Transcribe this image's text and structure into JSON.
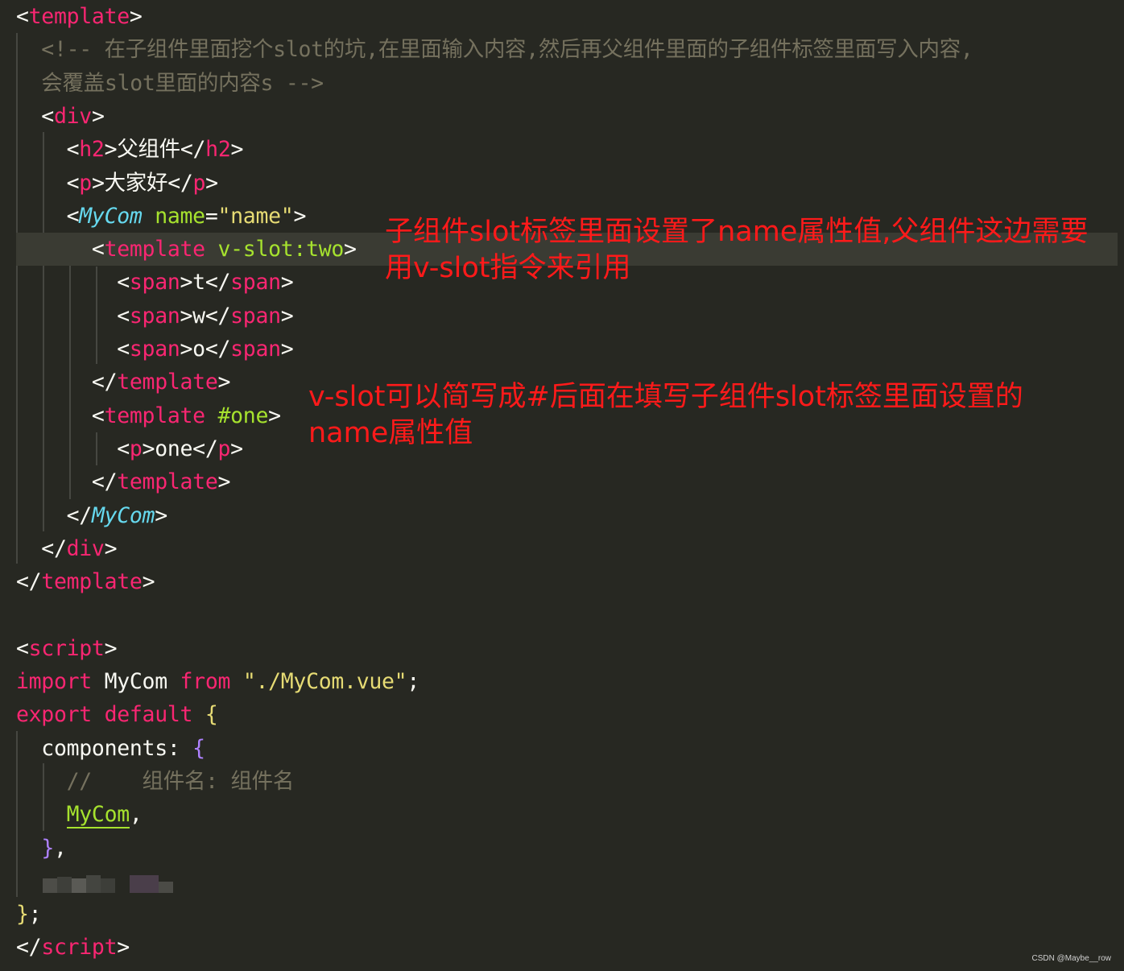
{
  "code_lines": [
    {
      "tokens": [
        {
          "t": "<",
          "c": "p"
        },
        {
          "t": "template",
          "c": "tag"
        },
        {
          "t": ">",
          "c": "p"
        }
      ]
    },
    {
      "tokens": [
        {
          "t": "  <!-- 在子组件里面挖个slot的坑,在里面输入内容,然后再父组件里面的子组件标签里面写入内容,",
          "c": "cmt"
        }
      ]
    },
    {
      "tokens": [
        {
          "t": "  会覆盖slot里面的内容s -->",
          "c": "cmt"
        }
      ]
    },
    {
      "tokens": [
        {
          "t": "  <",
          "c": "p"
        },
        {
          "t": "div",
          "c": "tag"
        },
        {
          "t": ">",
          "c": "p"
        }
      ]
    },
    {
      "tokens": [
        {
          "t": "    <",
          "c": "p"
        },
        {
          "t": "h2",
          "c": "tag"
        },
        {
          "t": ">父组件</",
          "c": "p"
        },
        {
          "t": "h2",
          "c": "tag"
        },
        {
          "t": ">",
          "c": "p"
        }
      ]
    },
    {
      "tokens": [
        {
          "t": "    <",
          "c": "p"
        },
        {
          "t": "p",
          "c": "tag"
        },
        {
          "t": ">大家好</",
          "c": "p"
        },
        {
          "t": "p",
          "c": "tag"
        },
        {
          "t": ">",
          "c": "p"
        }
      ]
    },
    {
      "tokens": [
        {
          "t": "    <",
          "c": "p"
        },
        {
          "t": "MyCom",
          "c": "cmp"
        },
        {
          "t": " ",
          "c": "p"
        },
        {
          "t": "name",
          "c": "attr"
        },
        {
          "t": "=",
          "c": "p"
        },
        {
          "t": "\"name\"",
          "c": "str"
        },
        {
          "t": ">",
          "c": "p"
        }
      ]
    },
    {
      "tokens": [
        {
          "t": "      <",
          "c": "p"
        },
        {
          "t": "template",
          "c": "tag"
        },
        {
          "t": " ",
          "c": "p"
        },
        {
          "t": "v-slot:two",
          "c": "attr"
        },
        {
          "t": ">",
          "c": "p"
        }
      ],
      "highlight": true
    },
    {
      "tokens": [
        {
          "t": "        <",
          "c": "p"
        },
        {
          "t": "span",
          "c": "tag"
        },
        {
          "t": ">t</",
          "c": "p"
        },
        {
          "t": "span",
          "c": "tag"
        },
        {
          "t": ">",
          "c": "p"
        }
      ]
    },
    {
      "tokens": [
        {
          "t": "        <",
          "c": "p"
        },
        {
          "t": "span",
          "c": "tag"
        },
        {
          "t": ">w</",
          "c": "p"
        },
        {
          "t": "span",
          "c": "tag"
        },
        {
          "t": ">",
          "c": "p"
        }
      ]
    },
    {
      "tokens": [
        {
          "t": "        <",
          "c": "p"
        },
        {
          "t": "span",
          "c": "tag"
        },
        {
          "t": ">o</",
          "c": "p"
        },
        {
          "t": "span",
          "c": "tag"
        },
        {
          "t": ">",
          "c": "p"
        }
      ]
    },
    {
      "tokens": [
        {
          "t": "      </",
          "c": "p"
        },
        {
          "t": "template",
          "c": "tag"
        },
        {
          "t": ">",
          "c": "p"
        }
      ]
    },
    {
      "tokens": [
        {
          "t": "      <",
          "c": "p"
        },
        {
          "t": "template",
          "c": "tag"
        },
        {
          "t": " ",
          "c": "p"
        },
        {
          "t": "#one",
          "c": "attr"
        },
        {
          "t": ">",
          "c": "p"
        }
      ]
    },
    {
      "tokens": [
        {
          "t": "        <",
          "c": "p"
        },
        {
          "t": "p",
          "c": "tag"
        },
        {
          "t": ">one</",
          "c": "p"
        },
        {
          "t": "p",
          "c": "tag"
        },
        {
          "t": ">",
          "c": "p"
        }
      ]
    },
    {
      "tokens": [
        {
          "t": "      </",
          "c": "p"
        },
        {
          "t": "template",
          "c": "tag"
        },
        {
          "t": ">",
          "c": "p"
        }
      ]
    },
    {
      "tokens": [
        {
          "t": "    </",
          "c": "p"
        },
        {
          "t": "MyCom",
          "c": "cmp"
        },
        {
          "t": ">",
          "c": "p"
        }
      ]
    },
    {
      "tokens": [
        {
          "t": "  </",
          "c": "p"
        },
        {
          "t": "div",
          "c": "tag"
        },
        {
          "t": ">",
          "c": "p"
        }
      ]
    },
    {
      "tokens": [
        {
          "t": "</",
          "c": "p"
        },
        {
          "t": "template",
          "c": "tag"
        },
        {
          "t": ">",
          "c": "p"
        }
      ]
    },
    {
      "tokens": []
    },
    {
      "tokens": [
        {
          "t": "<",
          "c": "p"
        },
        {
          "t": "script",
          "c": "tag"
        },
        {
          "t": ">",
          "c": "p"
        }
      ]
    },
    {
      "tokens": [
        {
          "t": "import",
          "c": "kw"
        },
        {
          "t": " MyCom ",
          "c": "p"
        },
        {
          "t": "from",
          "c": "kw"
        },
        {
          "t": " ",
          "c": "p"
        },
        {
          "t": "\"./MyCom.vue\"",
          "c": "str"
        },
        {
          "t": ";",
          "c": "p"
        }
      ]
    },
    {
      "tokens": [
        {
          "t": "export",
          "c": "kw"
        },
        {
          "t": " ",
          "c": "p"
        },
        {
          "t": "default",
          "c": "kw"
        },
        {
          "t": " ",
          "c": "p"
        },
        {
          "t": "{",
          "c": "brace1"
        }
      ]
    },
    {
      "tokens": [
        {
          "t": "  components: ",
          "c": "p"
        },
        {
          "t": "{",
          "c": "brace2"
        }
      ]
    },
    {
      "tokens": [
        {
          "t": "    //    组件名: 组件名",
          "c": "cmt"
        }
      ]
    },
    {
      "tokens": [
        {
          "t": "    ",
          "c": "p"
        },
        {
          "t": "MyCom",
          "c": "attr ul"
        },
        {
          "t": ",",
          "c": "p"
        }
      ]
    },
    {
      "tokens": [
        {
          "t": "  ",
          "c": "p"
        },
        {
          "t": "}",
          "c": "brace2"
        },
        {
          "t": ",",
          "c": "p"
        }
      ]
    },
    {
      "tokens": []
    },
    {
      "tokens": [
        {
          "t": "}",
          "c": "brace1"
        },
        {
          "t": ";",
          "c": "p"
        }
      ]
    },
    {
      "tokens": [
        {
          "t": "</",
          "c": "p"
        },
        {
          "t": "script",
          "c": "tag"
        },
        {
          "t": ">",
          "c": "p"
        }
      ]
    }
  ],
  "annotations": {
    "note1": "子组件slot标签里面设置了name属性值,父组件这边需要\n用v-slot指令来引用",
    "note2": "v-slot可以简写成#后面在填写子组件slot标签里面设置的\nname属性值"
  },
  "watermark": "CSDN @Maybe__row",
  "colors": {
    "background": "#272822",
    "tag": "#f92672",
    "component": "#66d9ef",
    "attribute": "#a6e22e",
    "string": "#e6db74",
    "comment": "#75715e",
    "annotation": "#ff1a1a"
  }
}
